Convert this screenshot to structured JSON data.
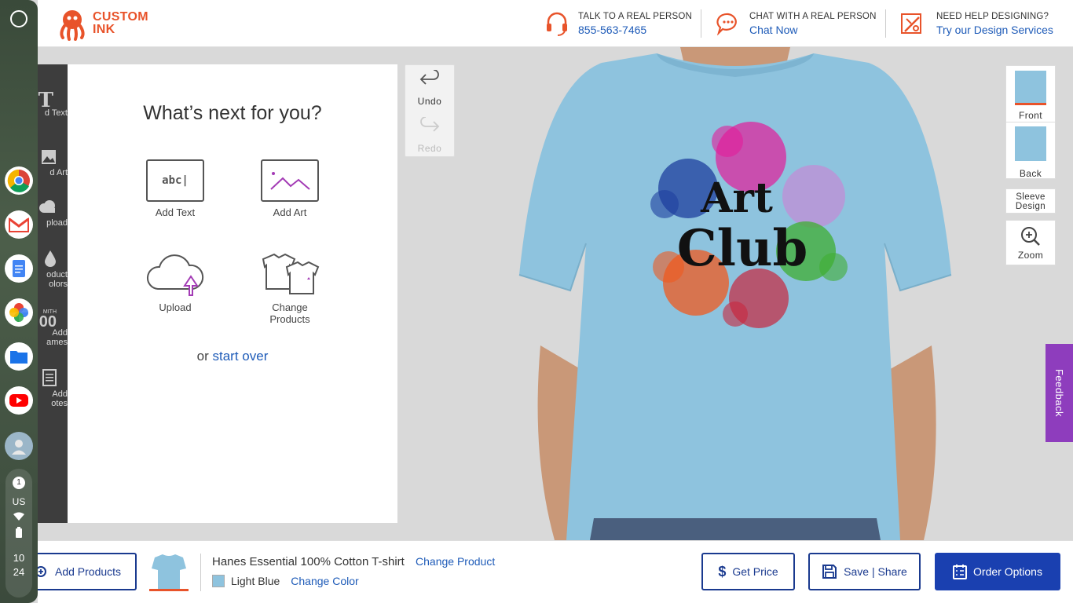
{
  "header": {
    "logo_line1": "CUSTOM",
    "logo_line2": "INK",
    "call_caption": "TALK TO A REAL PERSON",
    "call_number": "855-563-7465",
    "chat_caption": "CHAT WITH A REAL PERSON",
    "chat_link": "Chat Now",
    "help_caption": "NEED HELP DESIGNING?",
    "help_link": "Try our Design Services"
  },
  "rail": {
    "items": [
      {
        "label": "d Text",
        "icon": "T"
      },
      {
        "label": "d Art",
        "icon": "image-icon"
      },
      {
        "label": "pload",
        "icon": "cloud-icon"
      },
      {
        "label1": "oduct",
        "label2": "olors",
        "icon": "drop-icon"
      },
      {
        "label1": "Add",
        "label2": "ames",
        "icon_top": "MITH",
        "icon": "00"
      },
      {
        "label1": "Add",
        "label2": "otes",
        "icon": "notes-icon"
      }
    ]
  },
  "panel": {
    "title": "What’s next for you?",
    "tiles": [
      {
        "label": "Add Text",
        "glyph": "abc|"
      },
      {
        "label": "Add Art"
      },
      {
        "label": "Upload"
      },
      {
        "label1": "Change",
        "label2": "Products"
      }
    ],
    "or_text": "or",
    "start_over": "start over"
  },
  "undo": {
    "undo_label": "Undo",
    "redo_label": "Redo"
  },
  "design": {
    "line1": "Art",
    "line2": "Club",
    "shirt_color": "#8ec3de"
  },
  "views": {
    "front": "Front",
    "back": "Back",
    "sleeve1": "Sleeve",
    "sleeve2": "Design",
    "zoom": "Zoom"
  },
  "feedback": "Feedback",
  "footer": {
    "add_products": "Add Products",
    "product_name": "Hanes Essential 100% Cotton T-shirt",
    "change_product": "Change Product",
    "color_name": "Light Blue",
    "change_color": "Change Color",
    "get_price": "Get Price",
    "save_share": "Save | Share",
    "order_options": "Order Options"
  },
  "shelf": {
    "tray_badge": "1",
    "tray_locale": "US",
    "clock_hour": "10",
    "clock_minute": "24"
  },
  "colors": {
    "brand": "#e8532a",
    "link": "#1e5bb8",
    "primary": "#1a40b0",
    "feedback": "#8e3dbd"
  }
}
